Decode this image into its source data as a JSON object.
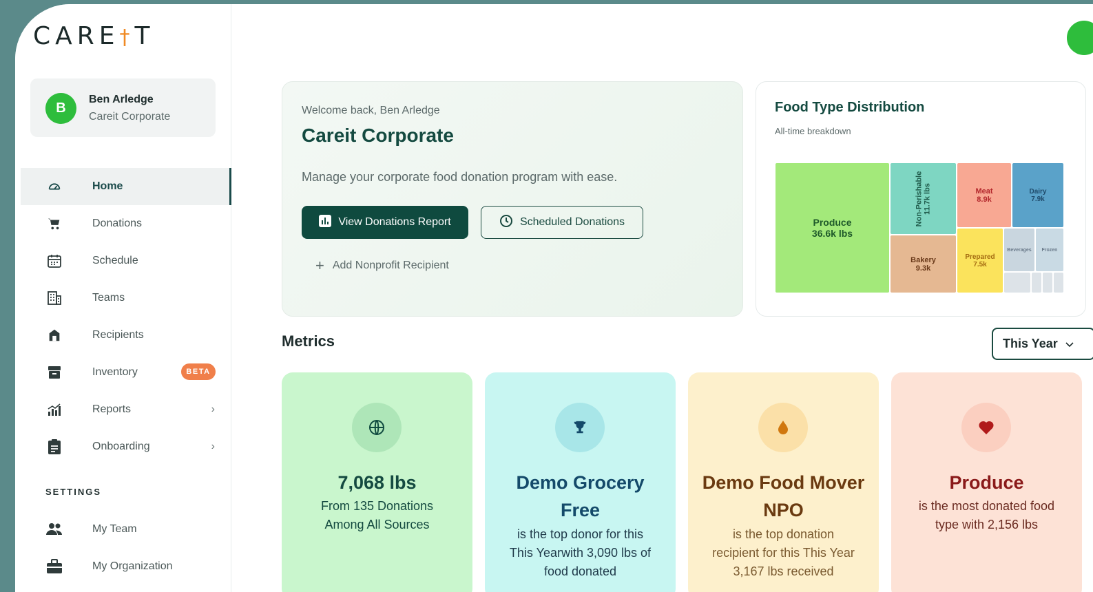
{
  "app": {
    "logo_text": "CARE",
    "logo_text_end": "T",
    "logo_carrot": "🥕"
  },
  "user": {
    "initial": "B",
    "name": "Ben Arledge",
    "organization": "Careit Corporate"
  },
  "nav": {
    "items": [
      {
        "label": "Home",
        "icon": "dashboard-icon",
        "active": true
      },
      {
        "label": "Donations",
        "icon": "cart-icon"
      },
      {
        "label": "Schedule",
        "icon": "calendar-icon"
      },
      {
        "label": "Teams",
        "icon": "building-icon"
      },
      {
        "label": "Recipients",
        "icon": "shop-icon"
      },
      {
        "label": "Inventory",
        "icon": "archive-icon",
        "badge": "BETA"
      },
      {
        "label": "Reports",
        "icon": "bar-chart-icon",
        "chevron": "›"
      },
      {
        "label": "Onboarding",
        "icon": "clipboard-icon",
        "chevron": "›"
      }
    ]
  },
  "settings": {
    "heading": "SETTINGS",
    "items": [
      {
        "label": "My Team",
        "icon": "people-icon"
      },
      {
        "label": "My Organization",
        "icon": "briefcase-icon"
      }
    ]
  },
  "welcome": {
    "subtitle": "Welcome back, Ben Arledge",
    "title": "Careit Corporate",
    "description": "Manage your corporate food donation program with ease.",
    "primary_button": "View Donations Report",
    "secondary_button": "Scheduled Donations",
    "link": "Add Nonprofit Recipient"
  },
  "food_distribution": {
    "title": "Food Type Distribution",
    "subtitle": "All-time breakdown",
    "tiles": [
      {
        "name": "Produce",
        "value": "36.6k lbs"
      },
      {
        "name": "Non-Perishable",
        "value": "11.7k lbs"
      },
      {
        "name": "Meat",
        "value": "8.9k"
      },
      {
        "name": "Dairy",
        "value": "7.9k"
      },
      {
        "name": "Bakery",
        "value": "9.3k"
      },
      {
        "name": "Prepared",
        "value": "7.5k"
      },
      {
        "name": "Beverages",
        "value": ""
      },
      {
        "name": "Frozen",
        "value": ""
      }
    ]
  },
  "chart_data": {
    "type": "treemap",
    "title": "Food Type Distribution",
    "subtitle": "All-time breakdown",
    "units": "lbs",
    "items": [
      {
        "name": "Produce",
        "value": 36600
      },
      {
        "name": "Non-Perishable",
        "value": 11700
      },
      {
        "name": "Bakery",
        "value": 9300
      },
      {
        "name": "Meat",
        "value": 8900
      },
      {
        "name": "Dairy",
        "value": 7900
      },
      {
        "name": "Prepared",
        "value": 7500
      }
    ]
  },
  "metrics": {
    "title": "Metrics",
    "period": "This Year",
    "cards": [
      {
        "value": "7,068 lbs",
        "description": "From 135 Donations Among All Sources",
        "icon": "globe-icon"
      },
      {
        "value": "Demo Grocery Free",
        "description": "is the top donor for this This Yearwith 3,090 lbs of food donated",
        "icon": "trophy-icon"
      },
      {
        "value": "Demo Food Mover NPO",
        "description": "is the top donation recipient for this This Year 3,167 lbs received",
        "icon": "drop-icon"
      },
      {
        "value": "Produce",
        "description": "is the most donated food type with 2,156 lbs",
        "icon": "heart-icon"
      }
    ]
  },
  "colors": {
    "brand_dark": "#0f4a3f",
    "avatar_green": "#2ebd3c",
    "beta_orange": "#f07f4a",
    "metric_green": "#c9f6cd",
    "metric_cyan": "#c8f6f2",
    "metric_yellow": "#fdf0cc",
    "metric_peach": "#fde2d6"
  }
}
